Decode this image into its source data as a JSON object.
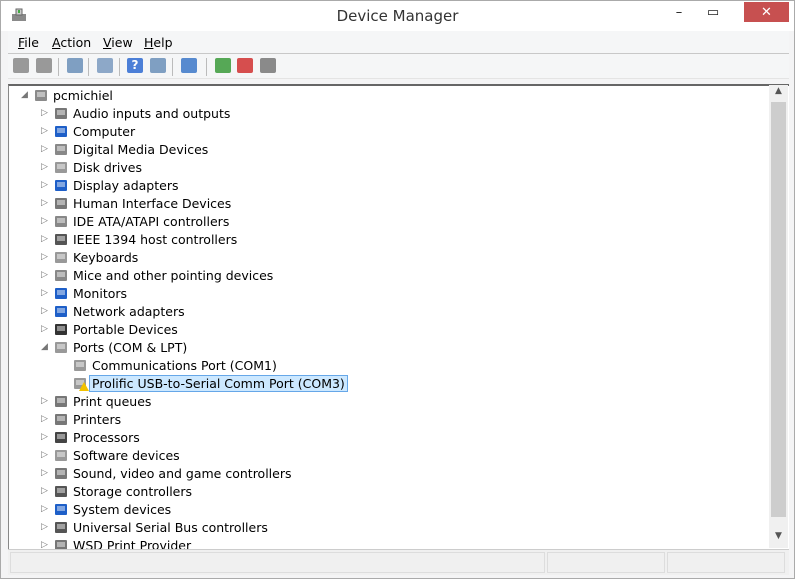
{
  "window": {
    "title": "Device Manager",
    "minimize": "–",
    "maximize": "▭",
    "close": "✕"
  },
  "menu": [
    {
      "label": "File",
      "key": "F",
      "rest": "ile"
    },
    {
      "label": "Action",
      "key": "A",
      "rest": "ction"
    },
    {
      "label": "View",
      "key": "V",
      "rest": "iew"
    },
    {
      "label": "Help",
      "key": "H",
      "rest": "elp"
    }
  ],
  "toolbar": [
    "back",
    "forward",
    "show-hide-console-tree",
    "properties",
    "help",
    "action-pane",
    "scan-hardware-changes",
    "update-driver",
    "disable-device",
    "uninstall-device"
  ],
  "tree": {
    "root": "pcmichiel",
    "categories": [
      {
        "label": "Audio inputs and outputs",
        "icon": "speaker-icon",
        "color": "#777"
      },
      {
        "label": "Computer",
        "icon": "computer-icon",
        "color": "#1e5fc8"
      },
      {
        "label": "Digital Media Devices",
        "icon": "media-device-icon",
        "color": "#888"
      },
      {
        "label": "Disk drives",
        "icon": "disk-drive-icon",
        "color": "#999"
      },
      {
        "label": "Display adapters",
        "icon": "display-adapter-icon",
        "color": "#1e5fc8"
      },
      {
        "label": "Human Interface Devices",
        "icon": "hid-icon",
        "color": "#777"
      },
      {
        "label": "IDE ATA/ATAPI controllers",
        "icon": "ide-controller-icon",
        "color": "#888"
      },
      {
        "label": "IEEE 1394 host controllers",
        "icon": "ieee1394-icon",
        "color": "#555"
      },
      {
        "label": "Keyboards",
        "icon": "keyboard-icon",
        "color": "#999"
      },
      {
        "label": "Mice and other pointing devices",
        "icon": "mouse-icon",
        "color": "#888"
      },
      {
        "label": "Monitors",
        "icon": "monitor-icon",
        "color": "#1e5fc8"
      },
      {
        "label": "Network adapters",
        "icon": "network-adapter-icon",
        "color": "#1e5fc8"
      },
      {
        "label": "Portable Devices",
        "icon": "portable-device-icon",
        "color": "#333"
      },
      {
        "label": "Ports (COM & LPT)",
        "icon": "port-icon",
        "color": "#999",
        "expanded": true,
        "children": [
          {
            "label": "Communications Port (COM1)",
            "warning": false
          },
          {
            "label": "Prolific USB-to-Serial Comm Port (COM3)",
            "warning": true,
            "selected": true
          }
        ]
      },
      {
        "label": "Print queues",
        "icon": "printer-icon",
        "color": "#777"
      },
      {
        "label": "Printers",
        "icon": "printer-icon",
        "color": "#777"
      },
      {
        "label": "Processors",
        "icon": "processor-icon",
        "color": "#444"
      },
      {
        "label": "Software devices",
        "icon": "software-device-icon",
        "color": "#999"
      },
      {
        "label": "Sound, video and game controllers",
        "icon": "speaker-icon",
        "color": "#777"
      },
      {
        "label": "Storage controllers",
        "icon": "storage-controller-icon",
        "color": "#555"
      },
      {
        "label": "System devices",
        "icon": "system-device-icon",
        "color": "#1e5fc8"
      },
      {
        "label": "Universal Serial Bus controllers",
        "icon": "usb-icon",
        "color": "#555"
      },
      {
        "label": "WSD Print Provider",
        "icon": "printer-icon",
        "color": "#777"
      }
    ]
  },
  "colors": {
    "selection_bg": "#cce8ff",
    "selection_border": "#66a7e8",
    "close_button": "#c75050",
    "warning": "#f2c200"
  }
}
